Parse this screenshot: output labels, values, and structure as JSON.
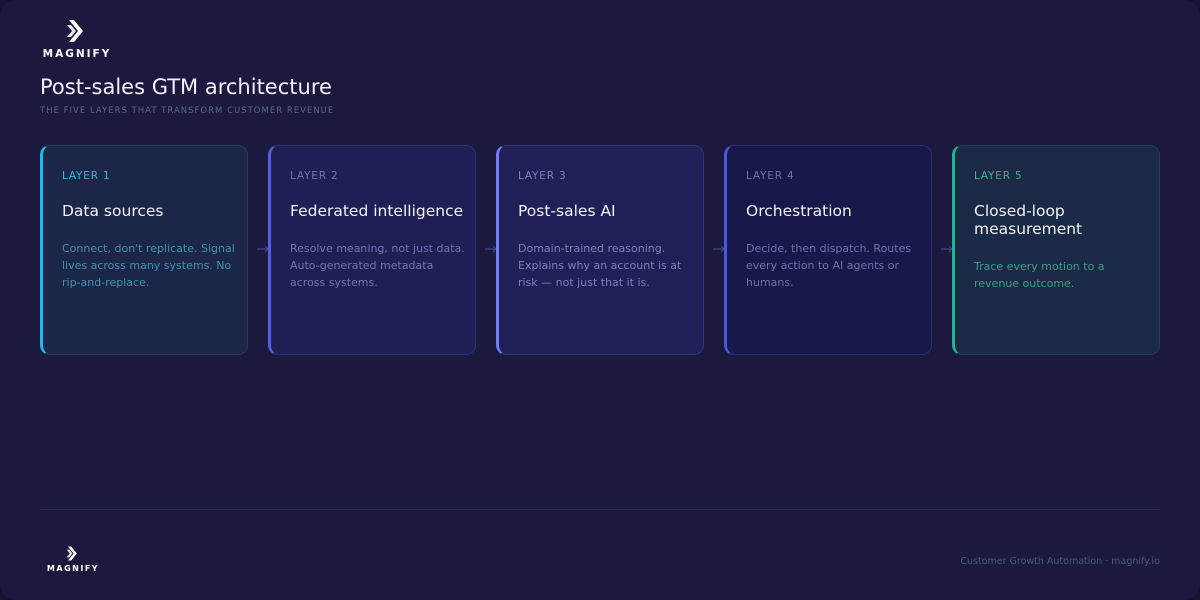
{
  "brand": {
    "name": "MAGNIFY",
    "logo_icon": "magnify-chevron-icon",
    "colors": {
      "background": "#1b1a3e",
      "text": "#f1f2fb"
    }
  },
  "header": {
    "title": "Post-sales GTM architecture",
    "subtitle": "THE FIVE LAYERS THAT TRANSFORM CUSTOMER REVENUE"
  },
  "layers": [
    {
      "label": "LAYER 1",
      "title": "Data sources",
      "description": "Connect, don't replicate. Signal lives across many systems. No rip-and-replace.",
      "accent": "#22b8e8"
    },
    {
      "label": "LAYER 2",
      "title": "Federated intelligence",
      "description": "Resolve meaning, not just data. Auto-generated metadata across systems.",
      "accent": "#4f5ee3"
    },
    {
      "label": "LAYER 3",
      "title": "Post-sales AI",
      "description": "Domain-trained reasoning. Explains why an account is at risk — not just that it is.",
      "accent": "#6f7ef5"
    },
    {
      "label": "LAYER 4",
      "title": "Orchestration",
      "description": "Decide, then dispatch. Routes every action to AI agents or humans.",
      "accent": "#4a57df"
    },
    {
      "label": "LAYER 5",
      "title": "Closed-loop measurement",
      "description": "Trace every motion to a revenue outcome.",
      "accent": "#22b38e"
    }
  ],
  "connector_icon": "arrow-right-icon",
  "footer": {
    "text": "Customer Growth Automation · magnify.io"
  }
}
